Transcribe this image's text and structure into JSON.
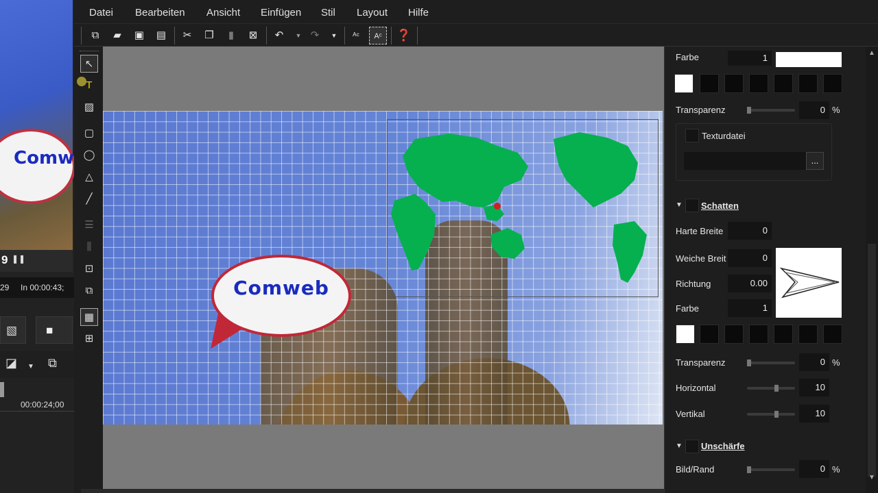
{
  "menu": {
    "items": [
      "Datei",
      "Bearbeiten",
      "Ansicht",
      "Einfügen",
      "Stil",
      "Layout",
      "Hilfe"
    ]
  },
  "left_preview": {
    "bubble_text": "Comwe",
    "timecode_a": "9",
    "timecode_b": "29",
    "timecode_in": "In 00:00:43;",
    "timecode_ruler": "00:00:24;00"
  },
  "canvas": {
    "bubble_text": "Comweb"
  },
  "panel": {
    "farbe_label": "Farbe",
    "farbe_value": "1",
    "transparenz_label": "Transparenz",
    "transparenz_value": "0",
    "percent": "%",
    "texturdatei_label": "Texturdatei",
    "browse_label": "...",
    "schatten_label": "Schatten",
    "harte_breite_label": "Harte Breite",
    "harte_breite_value": "0",
    "weiche_breite_label": "Weiche Breit",
    "weiche_breite_value": "0",
    "richtung_label": "Richtung",
    "richtung_value": "0.00",
    "farbe2_label": "Farbe",
    "farbe2_value": "1",
    "transparenz2_label": "Transparenz",
    "transparenz2_value": "0",
    "horizontal_label": "Horizontal",
    "horizontal_value": "10",
    "vertikal_label": "Vertikal",
    "vertikal_value": "10",
    "unschaerfe_label": "Unschärfe",
    "bildrand_label": "Bild/Rand",
    "bildrand_value": "0"
  },
  "colors": {
    "accent_green": "#06b04f",
    "bubble_border": "#c02838",
    "bubble_text": "#1a2bbf"
  }
}
